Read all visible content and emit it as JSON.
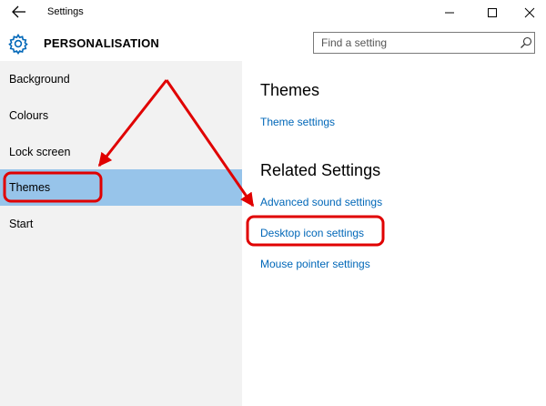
{
  "window": {
    "title": "Settings"
  },
  "header": {
    "section_title": "PERSONALISATION",
    "search_placeholder": "Find a setting"
  },
  "sidebar": {
    "items": [
      {
        "label": "Background"
      },
      {
        "label": "Colours"
      },
      {
        "label": "Lock screen"
      },
      {
        "label": "Themes",
        "selected": true
      },
      {
        "label": "Start"
      }
    ]
  },
  "main": {
    "themes_heading": "Themes",
    "theme_settings_link": "Theme settings",
    "related_heading": "Related Settings",
    "related_links": [
      {
        "label": "Advanced sound settings"
      },
      {
        "label": "Desktop icon settings"
      },
      {
        "label": "Mouse pointer settings"
      }
    ]
  },
  "colors": {
    "accent": "#0067b8",
    "selected_bg": "#97c4ea",
    "sidebar_bg": "#f2f2f2",
    "annotation": "#e00000"
  },
  "icons": {
    "back": "arrow-left-icon",
    "minimize": "minimize-icon",
    "maximize": "maximize-icon",
    "close": "close-icon",
    "settings": "gear-icon",
    "search": "search-icon"
  }
}
